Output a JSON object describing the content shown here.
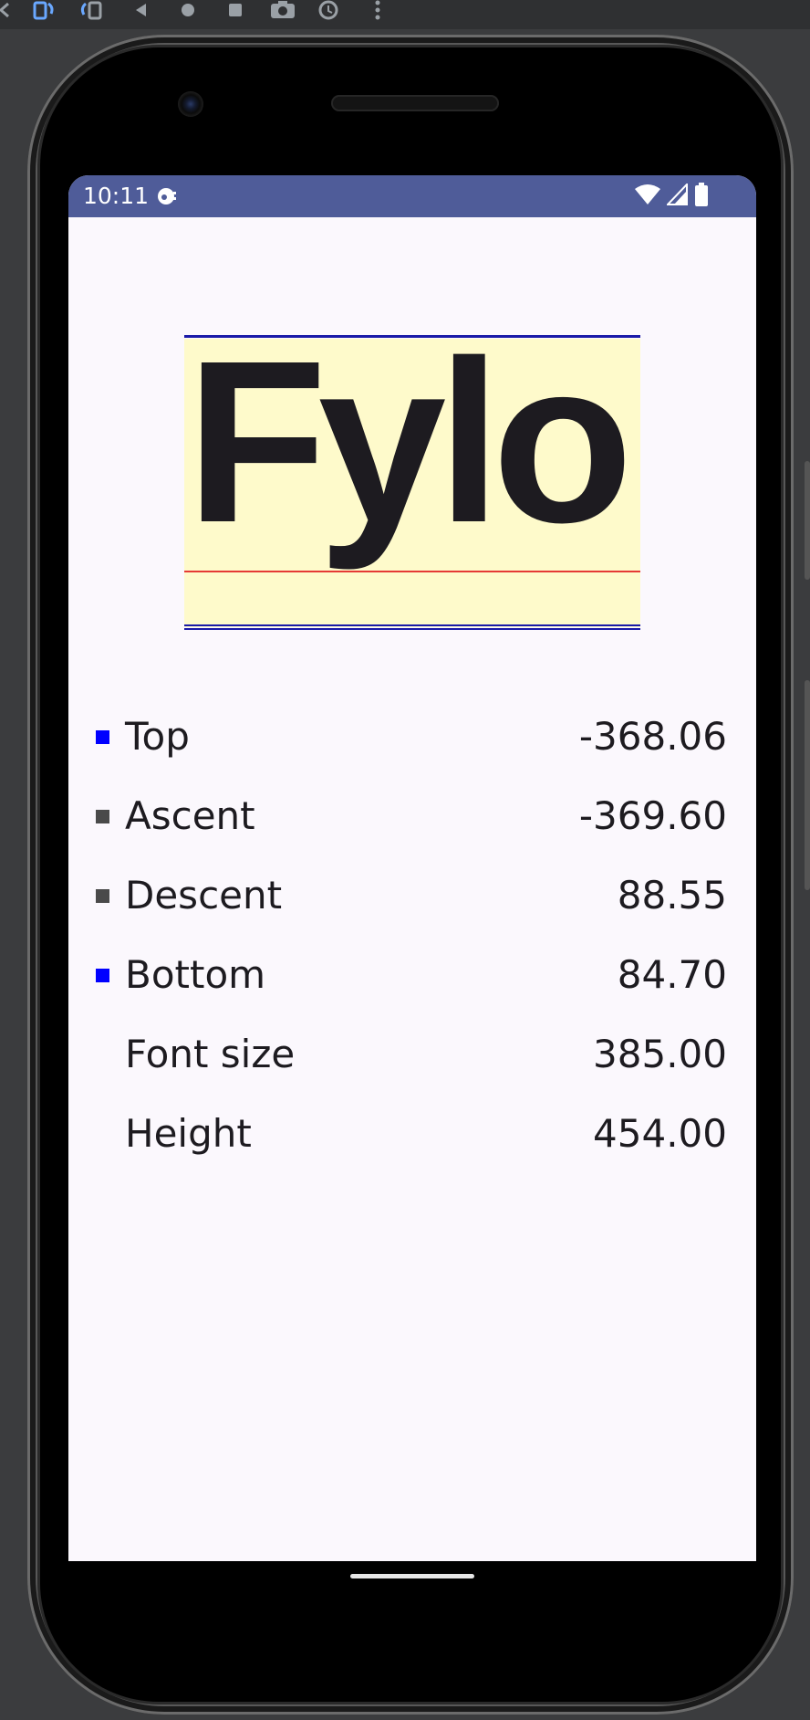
{
  "emulator_toolbar": {
    "icons": [
      "rotate-left-icon",
      "rotate-right-icon",
      "back-icon",
      "home-icon",
      "overview-icon",
      "screenshot-icon",
      "replay-icon",
      "more-icon"
    ]
  },
  "status_bar": {
    "time": "10:11",
    "icons": [
      "notification-icon",
      "wifi-icon",
      "signal-icon",
      "battery-icon"
    ],
    "color": "#4f5c99"
  },
  "specimen": {
    "word": "Fylo",
    "background_color": "#fefacb",
    "lines": [
      {
        "name": "top",
        "color": "#1a1aa8"
      },
      {
        "name": "baseline",
        "color": "#e53935"
      },
      {
        "name": "ascent",
        "color": "#4a4a4a"
      },
      {
        "name": "bottom",
        "color": "#1a1aa8"
      }
    ]
  },
  "metrics": [
    {
      "label": "Top",
      "value": "-368.06",
      "swatch": "#0000ff"
    },
    {
      "label": "Ascent",
      "value": "-369.60",
      "swatch": "#4a4a4a"
    },
    {
      "label": "Descent",
      "value": "88.55",
      "swatch": "#4a4a4a"
    },
    {
      "label": "Bottom",
      "value": "84.70",
      "swatch": "#0000ff"
    },
    {
      "label": "Font size",
      "value": "385.00",
      "swatch": null
    },
    {
      "label": "Height",
      "value": "454.00",
      "swatch": null
    }
  ]
}
